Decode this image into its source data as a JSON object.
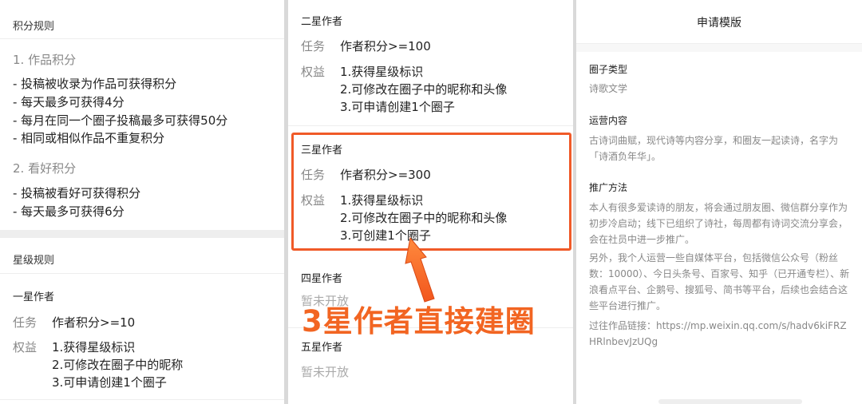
{
  "points_panel": {
    "title": "积分规则",
    "works_heading": "1. 作品积分",
    "works_rules": [
      "- 投稿被收录为作品可获得积分",
      "- 每天最多可获得4分",
      "- 每月在同一个圈子投稿最多可获得50分",
      "- 相同或相似作品不重复积分"
    ],
    "fav_heading": "2. 看好积分",
    "fav_rules": [
      "- 投稿被看好可获得积分",
      "- 每天最多可获得6分"
    ],
    "star_title": "星级规则",
    "one_star": {
      "name": "一星作者",
      "task_label": "任务",
      "task": "作者积分>=10",
      "benefit_label": "权益",
      "benefits": [
        "1.获得星级标识",
        "2.可修改在圈子中的昵称",
        "3.可申请创建1个圈子"
      ]
    }
  },
  "tiers_panel": {
    "two_star": {
      "name": "二星作者",
      "task_label": "任务",
      "task": "作者积分>=100",
      "benefit_label": "权益",
      "benefits": [
        "1.获得星级标识",
        "2.可修改在圈子中的昵称和头像",
        "3.可申请创建1个圈子"
      ]
    },
    "three_star": {
      "name": "三星作者",
      "task_label": "任务",
      "task": "作者积分>=300",
      "benefit_label": "权益",
      "benefits": [
        "1.获得星级标识",
        "2.可修改在圈子中的昵称和头像",
        "3.可创建1个圈子"
      ]
    },
    "four_star": {
      "name": "四星作者",
      "status": "暂未开放"
    },
    "five_star": {
      "name": "五星作者",
      "status": "暂未开放"
    },
    "annotation": "3星作者直接建圈"
  },
  "template_panel": {
    "title": "申请模版",
    "type_heading": "圈子类型",
    "type_value": "诗歌文学",
    "ops_heading": "运营内容",
    "ops_value": "古诗词曲赋，现代诗等内容分享，和圈友一起读诗，名字为「诗酒负年华」。",
    "promo_heading": "推广方法",
    "promo_p1": "本人有很多爱读诗的朋友，将会通过朋友圈、微信群分享作为初步冷启动；线下已组织了诗社，每周都有诗词交流分享会，会在社员中进一步推广。",
    "promo_p2": "另外，我个人运营一些自媒体平台，包括微信公众号（粉丝数：10000）、今日头条号、百家号、知乎（已开通专栏）、新浪看点平台、企鹅号、搜狐号、简书等平台，后续也会结合这些平台进行推广。",
    "promo_p3": "过往作品链接：https://mp.weixin.qq.com/s/hadv6kiFRZHRlnbevJzUQg"
  },
  "colors": {
    "highlight": "#f05a28",
    "annotation": "#f26522"
  }
}
